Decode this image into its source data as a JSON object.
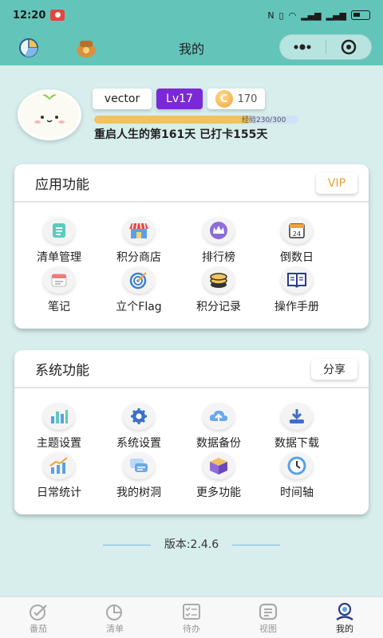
{
  "status_bar": {
    "time": "12:20",
    "notif_label": "NFC"
  },
  "title_bar": {
    "title": "我的"
  },
  "profile": {
    "username": "vector",
    "level": "Lv17",
    "coins": "170",
    "exp_text": "经验230/300",
    "exp_progress": 0.7667,
    "days_text": "重启人生的第161天 已打卡155天"
  },
  "app_section": {
    "title": "应用功能",
    "vip_label": "VIP",
    "items": [
      {
        "label": "清单管理",
        "icon": "checklist-icon"
      },
      {
        "label": "积分商店",
        "icon": "shop-icon"
      },
      {
        "label": "排行榜",
        "icon": "crown-icon"
      },
      {
        "label": "倒数日",
        "icon": "calendar-24-icon"
      },
      {
        "label": "笔记",
        "icon": "note-icon"
      },
      {
        "label": "立个Flag",
        "icon": "target-icon"
      },
      {
        "label": "积分记录",
        "icon": "coin-stack-icon"
      },
      {
        "label": "操作手册",
        "icon": "book-icon"
      }
    ]
  },
  "sys_section": {
    "title": "系统功能",
    "share_label": "分享",
    "items": [
      {
        "label": "主题设置",
        "icon": "theme-chart-icon"
      },
      {
        "label": "系统设置",
        "icon": "gear-icon"
      },
      {
        "label": "数据备份",
        "icon": "cloud-upload-icon"
      },
      {
        "label": "数据下载",
        "icon": "download-icon"
      },
      {
        "label": "日常统计",
        "icon": "trend-chart-icon"
      },
      {
        "label": "我的树洞",
        "icon": "chat-icon"
      },
      {
        "label": "更多功能",
        "icon": "cube-icon"
      },
      {
        "label": "时间轴",
        "icon": "clock-icon"
      }
    ]
  },
  "version": "版本:2.4.6",
  "bottom_nav": [
    {
      "label": "番茄",
      "icon": "tomato-timer-icon",
      "active": false
    },
    {
      "label": "清单",
      "icon": "pie-list-icon",
      "active": false
    },
    {
      "label": "待办",
      "icon": "todo-icon",
      "active": false
    },
    {
      "label": "视图",
      "icon": "view-icon",
      "active": false
    },
    {
      "label": "我的",
      "icon": "profile-icon",
      "active": true
    }
  ],
  "colors": {
    "accent": "#63c4ba",
    "level_chip": "#7b28d6",
    "vip": "#e0a33c",
    "exp_fill": "#f0c35c"
  }
}
